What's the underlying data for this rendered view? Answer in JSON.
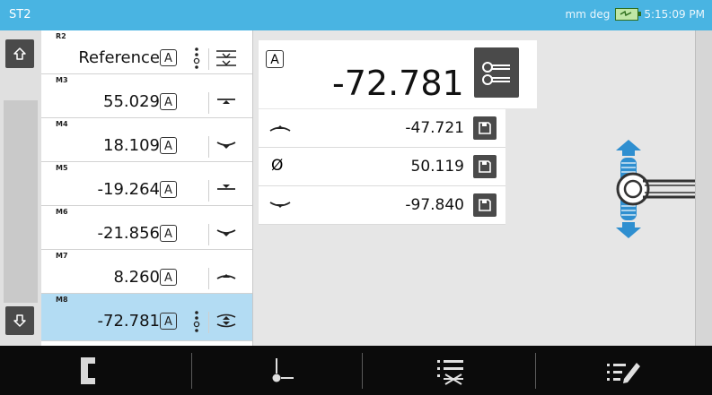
{
  "header": {
    "title": "ST2",
    "units": "mm deg",
    "time": "5:15:09 PM"
  },
  "rows": [
    {
      "id": "R2",
      "value": "Reference",
      "mode": "A"
    },
    {
      "id": "M3",
      "value": "55.029",
      "mode": "A"
    },
    {
      "id": "M4",
      "value": "18.109",
      "mode": "A"
    },
    {
      "id": "M5",
      "value": "-19.264",
      "mode": "A"
    },
    {
      "id": "M6",
      "value": "-21.856",
      "mode": "A"
    },
    {
      "id": "M7",
      "value": "8.260",
      "mode": "A"
    },
    {
      "id": "M8",
      "value": "-72.781",
      "mode": "A"
    }
  ],
  "detail": {
    "mode": "A",
    "value": "-72.781",
    "measurements": [
      {
        "type": "max-icon",
        "value": "-47.721"
      },
      {
        "type": "diameter-icon",
        "value": "50.119",
        "symbol": "Ø"
      },
      {
        "type": "min-icon",
        "value": "-97.840"
      }
    ]
  },
  "colors": {
    "header": "#49b4e2",
    "selected_row": "#b3dcf3",
    "button": "#4a4a4a",
    "probe": "#2f8fd0"
  }
}
